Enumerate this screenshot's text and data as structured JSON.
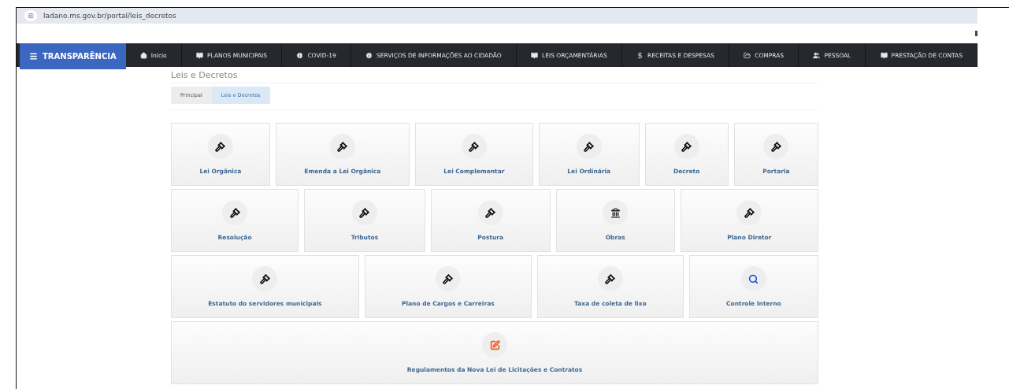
{
  "browser": {
    "url": "ladano.ms.gov.br/portal/leis_decretos"
  },
  "navbar": {
    "brand": "TRANSPARÊNCIA",
    "items": [
      {
        "label": "Início",
        "kind": "home"
      },
      {
        "label": "PLANOS MUNICIPAIS",
        "kind": "book"
      },
      {
        "label": "COVID-19",
        "kind": "info"
      },
      {
        "label": "SERVIÇOS DE INFORMAÇÕES AO CIDADÃO",
        "kind": "info"
      },
      {
        "label": "LEIS ORÇAMENTÁRIAS",
        "kind": "book"
      },
      {
        "label": "RECEITAS E DESPESAS",
        "kind": "dollar"
      },
      {
        "label": "COMPRAS",
        "kind": "folder"
      },
      {
        "label": "PESSOAL",
        "kind": "users"
      },
      {
        "label": "PRESTAÇÃO DE CONTAS",
        "kind": "book"
      }
    ]
  },
  "page_title": "Leis e Decretos",
  "breadcrumb": [
    {
      "label": "Principal",
      "selected": false
    },
    {
      "label": "Leis e Decretos",
      "selected": true
    }
  ],
  "card_rows": [
    [
      {
        "label": "Lei Orgânica",
        "kind": "gavel"
      },
      {
        "label": "Emenda a Lei Orgânica",
        "kind": "gavel"
      },
      {
        "label": "Lei Complementar",
        "kind": "gavel"
      },
      {
        "label": "Lei Ordinária",
        "kind": "gavel"
      },
      {
        "label": "Decreto",
        "kind": "gavel"
      },
      {
        "label": "Portaria",
        "kind": "gavel"
      }
    ],
    [
      {
        "label": "Resolução",
        "kind": "gavel"
      },
      {
        "label": "Tributos",
        "kind": "gavel"
      },
      {
        "label": "Postura",
        "kind": "gavel"
      },
      {
        "label": "Obras",
        "kind": "bank"
      },
      {
        "label": "Plano Diretor",
        "kind": "gavel"
      }
    ],
    [
      {
        "label": "Estatuto do servidores municipais",
        "kind": "gavel"
      },
      {
        "label": "Plano de Cargos e Carreiras",
        "kind": "gavel"
      },
      {
        "label": "Taxa de coleta de lixo",
        "kind": "gavel"
      },
      {
        "label": "Controle Interno",
        "kind": "search"
      }
    ],
    [
      {
        "label": "Regulamentos da Nova Lei de Licitações e Contratos",
        "kind": "edit"
      }
    ]
  ]
}
